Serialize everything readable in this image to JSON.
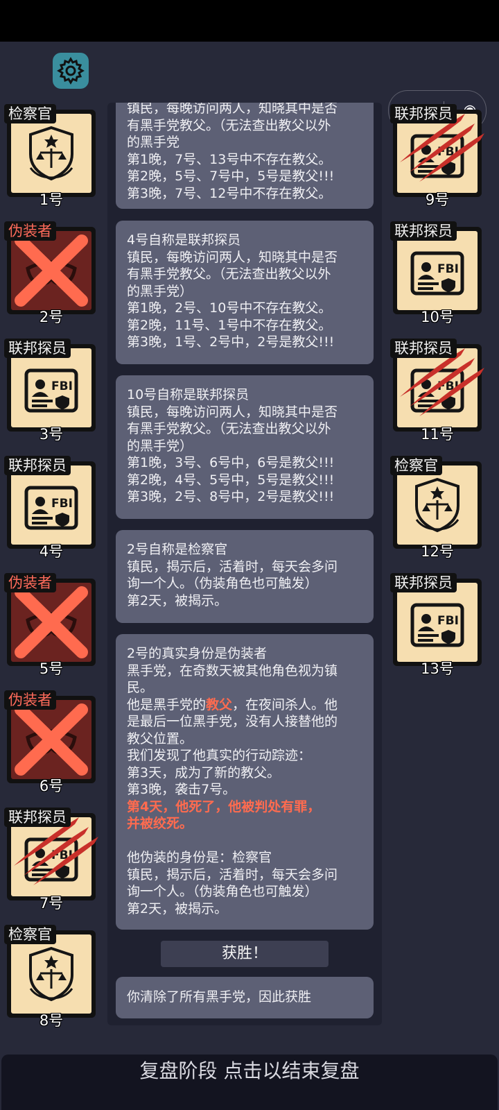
{
  "app": {
    "capsule_menu": "•••",
    "capsule_close": "◉"
  },
  "players": [
    {
      "id": "p1",
      "role": "检察官",
      "num": "1号",
      "icon": "prosecutor-badge-icon",
      "status": "alive"
    },
    {
      "id": "p2",
      "role": "伪装者",
      "num": "2号",
      "icon": "mask-icon",
      "status": "executed"
    },
    {
      "id": "p3",
      "role": "联邦探员",
      "num": "3号",
      "icon": "fbi-id-icon",
      "status": "alive"
    },
    {
      "id": "p4",
      "role": "联邦探员",
      "num": "4号",
      "icon": "fbi-id-icon",
      "status": "alive"
    },
    {
      "id": "p5",
      "role": "伪装者",
      "num": "5号",
      "icon": "mask-icon",
      "status": "executed"
    },
    {
      "id": "p6",
      "role": "伪装者",
      "num": "6号",
      "icon": "mask-icon",
      "status": "executed"
    },
    {
      "id": "p7",
      "role": "联邦探员",
      "num": "7号",
      "icon": "fbi-id-icon",
      "status": "killed"
    },
    {
      "id": "p8",
      "role": "检察官",
      "num": "8号",
      "icon": "prosecutor-badge-icon",
      "status": "alive"
    },
    {
      "id": "p9",
      "role": "联邦探员",
      "num": "9号",
      "icon": "fbi-id-icon",
      "status": "killed"
    },
    {
      "id": "p10",
      "role": "联邦探员",
      "num": "10号",
      "icon": "fbi-id-icon",
      "status": "alive"
    },
    {
      "id": "p11",
      "role": "联邦探员",
      "num": "11号",
      "icon": "fbi-id-icon",
      "status": "killed"
    },
    {
      "id": "p12",
      "role": "检察官",
      "num": "12号",
      "icon": "prosecutor-badge-icon",
      "status": "alive"
    },
    {
      "id": "p13",
      "role": "联邦探员",
      "num": "13号",
      "icon": "fbi-id-icon",
      "status": "alive"
    }
  ],
  "log": {
    "b1": [
      "镇民，每晚访问两人，知晓其中是否",
      "有黑手党教父。（无法查出教父以外",
      "的黑手党",
      "第1晚，7号、13号中不存在教父。",
      "第2晚，5号、7号中，5号是教父!!!",
      "第3晚，7号、12号中不存在教父。"
    ],
    "b2": [
      "4号自称是联邦探员",
      "镇民，每晚访问两人，知晓其中是否",
      "有黑手党教父。（无法查出教父以外",
      "的黑手党）",
      "第1晚，2号、10号中不存在教父。",
      "第2晚，11号、1号中不存在教父。",
      "第3晚，1号、2号中，2号是教父!!!"
    ],
    "b3": [
      "10号自称是联邦探员",
      "镇民，每晚访问两人，知晓其中是否",
      "有黑手党教父。（无法查出教父以外",
      "的黑手党）",
      "第1晚，3号、6号中，6号是教父!!!",
      "第2晚，4号、5号中，5号是教父!!!",
      "第3晚，2号、8号中，2号是教父!!!"
    ],
    "b4": [
      "2号自称是检察官",
      "镇民，揭示后，活着时，每天会多问",
      "询一个人。（伪装角色也可触发）",
      "第2天，被揭示。"
    ],
    "b5": {
      "l1": "2号的真实身份是伪装者",
      "l2": "黑手党，在奇数天被其他角色视为镇",
      "l3": "民。",
      "l4a": "他是黑手党的",
      "l4b": "教父",
      "l4c": "，在夜间杀人。他",
      "l5": "是最后一位黑手党，没有人接替他的",
      "l6": "教父位置。",
      "l7": "我们发现了他真实的行动踪迹：",
      "l8": "第3天，成为了新的教父。",
      "l9": "第3晚，袭击7号。",
      "l10": "第4天，他死了，他被判处有罪，",
      "l11": "并被绞死。",
      "l12": "他伪装的身份是：检察官",
      "l13": "镇民，揭示后，活着时，每天会多问",
      "l14": "询一个人。（伪装角色也可触发）",
      "l15": "第2天，被揭示。"
    },
    "victory_label": "获胜！",
    "victory_text": "你清除了所有黑手党，因此获胜"
  },
  "bottom_bar": "复盘阶段 点击以结束复盘",
  "colors": {
    "background": "#272939",
    "bubble": "#5d6075",
    "card": "#f6deb0",
    "dead_card": "#6b2320",
    "highlight": "#ff6b4f",
    "claw": "#c8302a"
  }
}
